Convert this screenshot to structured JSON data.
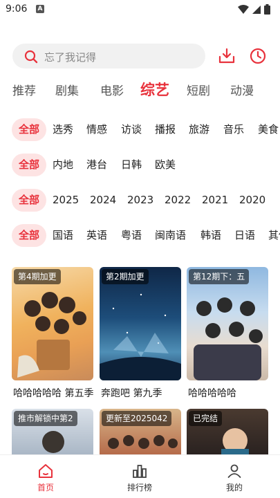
{
  "status_bar": {
    "time": "9:06",
    "notification_letter": "A"
  },
  "search": {
    "placeholder": "忘了我记得"
  },
  "tabs": [
    {
      "label": "推荐"
    },
    {
      "label": "剧集"
    },
    {
      "label": "电影"
    },
    {
      "label": "综艺",
      "active": true
    },
    {
      "label": "短剧"
    },
    {
      "label": "动漫"
    }
  ],
  "filters": {
    "genre": {
      "all": "全部",
      "options": [
        "选秀",
        "情感",
        "访谈",
        "播报",
        "旅游",
        "音乐",
        "美食"
      ]
    },
    "region": {
      "all": "全部",
      "options": [
        "内地",
        "港台",
        "日韩",
        "欧美"
      ]
    },
    "year": {
      "all": "全部",
      "options": [
        "2025",
        "2024",
        "2023",
        "2022",
        "2021",
        "2020"
      ]
    },
    "language": {
      "all": "全部",
      "options": [
        "国语",
        "英语",
        "粤语",
        "闽南语",
        "韩语",
        "日语",
        "其他"
      ]
    }
  },
  "cards": [
    {
      "badge": "第4期加更",
      "title": "哈哈哈哈哈 第五季"
    },
    {
      "badge": "第2期加更",
      "title": "奔跑吧 第九季"
    },
    {
      "badge": "第12期下：五",
      "title": "哈哈哈哈哈"
    },
    {
      "badge": "推市解锁中第2",
      "title": ""
    },
    {
      "badge": "更新至2025042",
      "title": ""
    },
    {
      "badge": "已完结",
      "title": ""
    }
  ],
  "bottom_nav": [
    {
      "label": "首页",
      "active": true
    },
    {
      "label": "排行榜"
    },
    {
      "label": "我的"
    }
  ],
  "colors": {
    "accent": "#e8323c",
    "chip_bg": "#fde3e3",
    "search_bg": "#f1f1f1"
  }
}
